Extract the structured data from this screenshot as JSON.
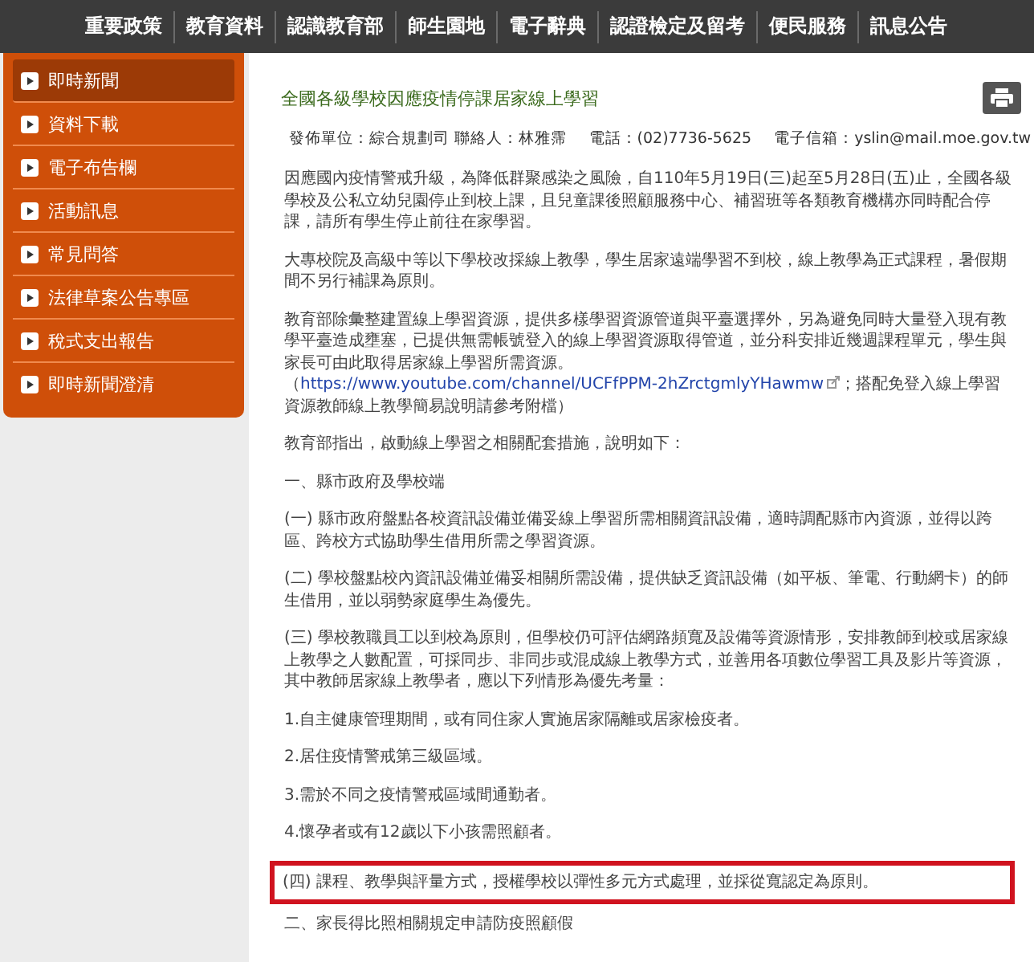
{
  "top_nav": [
    {
      "label": "重要政策"
    },
    {
      "label": "教育資料"
    },
    {
      "label": "認識教育部"
    },
    {
      "label": "師生園地"
    },
    {
      "label": "電子辭典"
    },
    {
      "label": "認證檢定及留考"
    },
    {
      "label": "便民服務"
    },
    {
      "label": "訊息公告"
    }
  ],
  "sidebar": {
    "items": [
      {
        "label": "即時新聞",
        "selected": true
      },
      {
        "label": "資料下載",
        "selected": false
      },
      {
        "label": "電子布告欄",
        "selected": false
      },
      {
        "label": "活動訊息",
        "selected": false
      },
      {
        "label": "常見問答",
        "selected": false
      },
      {
        "label": "法律草案公告專區",
        "selected": false
      },
      {
        "label": "稅式支出報告",
        "selected": false
      },
      {
        "label": "即時新聞澄清",
        "selected": false
      }
    ]
  },
  "article": {
    "title": "全國各級學校因應疫情停課居家線上學習",
    "meta": [
      {
        "label": "發佈單位：綜合規劃司 聯絡人：林雅霈"
      },
      {
        "label": "電話：(02)7736-5625"
      },
      {
        "label": "電子信箱：yslin@mail.moe.gov.tw"
      }
    ],
    "paragraphs": [
      {
        "kind": "text",
        "text": "因應國內疫情警戒升級，為降低群聚感染之風險，自110年5月19日(三)起至5月28日(五)止，全國各級學校及公私立幼兒園停止到校上課，且兒童課後照顧服務中心、補習班等各類教育機構亦同時配合停課，請所有學生停止前往在家學習。",
        "highlighted": false
      },
      {
        "kind": "text",
        "text": "大專校院及高級中等以下學校改採線上教學，學生居家遠端學習不到校，線上教學為正式課程，暑假期間不另行補課為原則。",
        "highlighted": false
      },
      {
        "kind": "link",
        "before": "教育部除彙整建置線上學習資源，提供多樣學習資源管道與平臺選擇外，另為避免同時大量登入現有教學平臺造成壅塞，已提供無需帳號登入的線上學習資源取得管道，並分科安排近幾週課程單元，學生與家長可由此取得居家線上學習所需資源。（",
        "link": "https://www.youtube.com/channel/UCFfPPM-2hZrctgmlyYHawmw",
        "after": "；搭配免登入線上學習資源教師線上教學簡易說明請參考附檔）",
        "highlighted": false
      },
      {
        "kind": "text",
        "text": "教育部指出，啟動線上學習之相關配套措施，說明如下：",
        "highlighted": false
      },
      {
        "kind": "text",
        "text": "一、縣市政府及學校端",
        "highlighted": false
      },
      {
        "kind": "text",
        "text": "(一) 縣市政府盤點各校資訊設備並備妥線上學習所需相關資訊設備，適時調配縣市內資源，並得以跨區、跨校方式協助學生借用所需之學習資源。",
        "highlighted": false
      },
      {
        "kind": "text",
        "text": "(二) 學校盤點校內資訊設備並備妥相關所需設備，提供缺乏資訊設備（如平板、筆電、行動網卡）的師生借用，並以弱勢家庭學生為優先。",
        "highlighted": false
      },
      {
        "kind": "text",
        "text": "(三) 學校教職員工以到校為原則，但學校仍可評估網路頻寬及設備等資源情形，安排教師到校或居家線上教學之人數配置，可採同步、非同步或混成線上教學方式，並善用各項數位學習工具及影片等資源，其中教師居家線上教學者，應以下列情形為優先考量：",
        "highlighted": false
      },
      {
        "kind": "text",
        "text": "1.自主健康管理期間，或有同住家人實施居家隔離或居家檢疫者。",
        "highlighted": false
      },
      {
        "kind": "text",
        "text": "2.居住疫情警戒第三級區域。",
        "highlighted": false
      },
      {
        "kind": "text",
        "text": "3.需於不同之疫情警戒區域間通勤者。",
        "highlighted": false
      },
      {
        "kind": "text",
        "text": "4.懷孕者或有12歲以下小孩需照顧者。",
        "highlighted": false
      },
      {
        "kind": "text",
        "text": "(四) 課程、教學與評量方式，授權學校以彈性多元方式處理，並採從寬認定為原則。",
        "highlighted": true
      },
      {
        "kind": "text",
        "text": "二、家長得比照相關規定申請防疫照顧假",
        "highlighted": false
      }
    ]
  }
}
